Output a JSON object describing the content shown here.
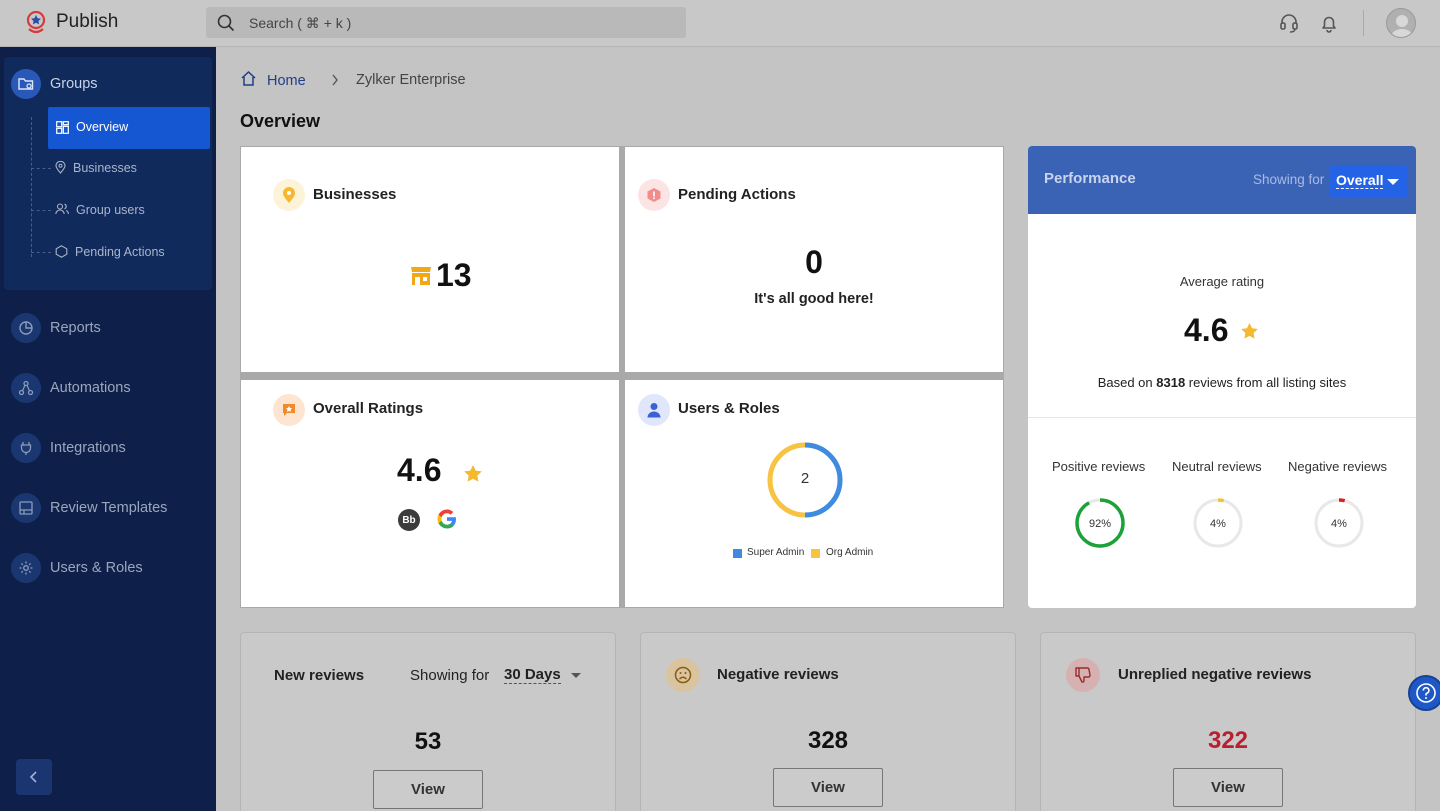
{
  "app": {
    "title": "Publish"
  },
  "search": {
    "placeholder": "Search ( ⌘ + k )"
  },
  "topbar": {
    "icons": [
      "headset-icon",
      "bell-icon",
      "avatar"
    ]
  },
  "sidebar": {
    "groups_label": "Groups",
    "sub_items": [
      {
        "label": "Overview",
        "icon": "grid-icon",
        "active": true
      },
      {
        "label": "Businesses",
        "icon": "location-pin-icon"
      },
      {
        "label": "Group users",
        "icon": "users-icon"
      },
      {
        "label": "Pending Actions",
        "icon": "hexagon-alert-icon"
      }
    ],
    "items": [
      {
        "label": "Reports",
        "icon": "pie-chart-icon"
      },
      {
        "label": "Automations",
        "icon": "workflow-icon"
      },
      {
        "label": "Integrations",
        "icon": "plug-icon"
      },
      {
        "label": "Review Templates",
        "icon": "template-icon"
      },
      {
        "label": "Users & Roles",
        "icon": "gear-icon"
      }
    ]
  },
  "breadcrumb": {
    "home": "Home",
    "current": "Zylker Enterprise"
  },
  "page_title": "Overview",
  "cards": {
    "businesses": {
      "title": "Businesses",
      "count": "13"
    },
    "pending": {
      "title": "Pending Actions",
      "count": "0",
      "message": "It's all good here!"
    },
    "ratings": {
      "title": "Overall Ratings",
      "value": "4.6",
      "source_badge": "Bb"
    },
    "users_roles": {
      "title": "Users & Roles",
      "total": "2",
      "legend": [
        {
          "label": "Super Admin",
          "color": "#3f8be0",
          "value": 1
        },
        {
          "label": "Org Admin",
          "color": "#f6c342",
          "value": 1
        }
      ]
    }
  },
  "performance": {
    "title": "Performance",
    "showing_for_label": "Showing for",
    "selected": "Overall",
    "avg_label": "Average rating",
    "avg_value": "4.6",
    "based_prefix": "Based on ",
    "review_count": "8318",
    "based_suffix": " reviews from all listing sites",
    "breakdown": [
      {
        "label": "Positive reviews",
        "percent_text": "92%",
        "percent": 92,
        "color": "#1da23a"
      },
      {
        "label": "Neutral reviews",
        "percent_text": "4%",
        "percent": 4,
        "color": "#f2c230"
      },
      {
        "label": "Negative reviews",
        "percent_text": "4%",
        "percent": 4,
        "color": "#d42020"
      }
    ]
  },
  "bottom": {
    "new_reviews": {
      "title": "New reviews",
      "showing_for": "Showing for",
      "period": "30 Days",
      "count": "53",
      "button": "View"
    },
    "negative_reviews": {
      "title": "Negative reviews",
      "count": "328",
      "button": "View"
    },
    "unreplied_negative": {
      "title": "Unreplied negative reviews",
      "count": "322",
      "count_color": "#b81f2f",
      "button": "View"
    }
  },
  "colors": {
    "sidebar": "#0e2049",
    "accent": "#1556d2",
    "performance_header": "#3a63b6"
  }
}
